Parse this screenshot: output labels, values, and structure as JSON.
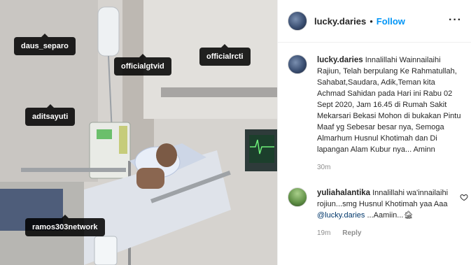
{
  "photo": {
    "tags": [
      {
        "label": "daus_separo"
      },
      {
        "label": "officialgtvid"
      },
      {
        "label": "officialrcti"
      },
      {
        "label": "aditsayuti"
      },
      {
        "label": "ramos303network"
      }
    ]
  },
  "header": {
    "username": "lucky.daries",
    "separator": "•",
    "follow_label": "Follow",
    "more_icon": "more-horizontal-icon"
  },
  "caption": {
    "username": "lucky.daries",
    "text": "Innalillahi Wainnailaihi Rajiun, Telah berpulang Ke Rahmatullah, Sahabat,Saudara, Adik,Teman kita Achmad Sahidan pada Hari ini Rabu 02 Sept 2020, Jam 16.45 di Rumah Sakit Mekarsari Bekasi Mohon di bukakan Pintu Maaf yg Sebesar besar nya, Semoga Almarhum Husnul Khotimah dan Di lapangan Alam Kubur nya... Aminn",
    "time": "30m"
  },
  "comments": [
    {
      "username": "yuliahalantika",
      "text_before": "Innalillahi wa'innailaihi rojiun...smg Husnul Khotimah yaa Aaa ",
      "mention": "@lucky.daries",
      "text_after": " ...Aamiin...🏚",
      "time": "19m",
      "reply_label": "Reply"
    }
  ],
  "colors": {
    "accent": "#0095f6",
    "text": "#262626",
    "muted": "#8e8e8e",
    "mention": "#00376b"
  }
}
